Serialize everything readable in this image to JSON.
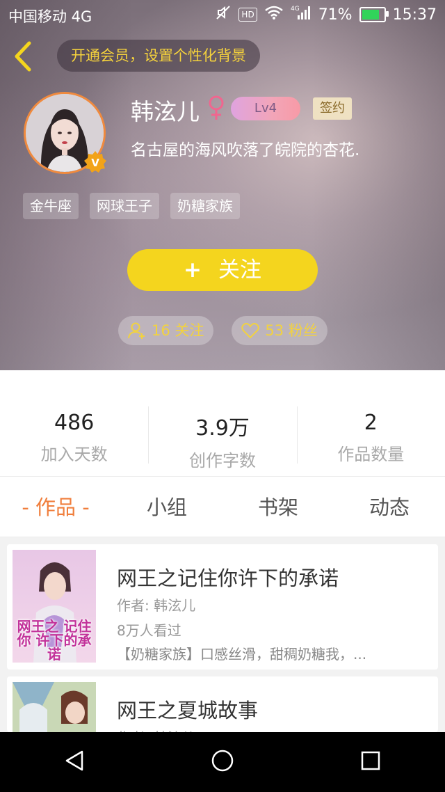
{
  "status_bar": {
    "carrier": "中国移动 4G",
    "network": "4G",
    "battery": "71%",
    "time": "15:37"
  },
  "header": {
    "vip_prompt": "开通会员，设置个性化背景",
    "username": "韩泫儿",
    "gender": "female",
    "level": "Lv4",
    "sign_badge": "签约",
    "bio": "名古屋的海风吹落了皖院的杏花.",
    "tags": [
      "金牛座",
      "网球王子",
      "奶糖家族"
    ],
    "follow_button": "关注",
    "follow_plus": "+",
    "following": "16 关注",
    "fans": "53 粉丝"
  },
  "stats": [
    {
      "value": "486",
      "label": "加入天数"
    },
    {
      "value": "3.9万",
      "label": "创作字数"
    },
    {
      "value": "2",
      "label": "作品数量"
    }
  ],
  "tabs": [
    {
      "label": "- 作品 -",
      "active": true
    },
    {
      "label": "小组"
    },
    {
      "label": "书架"
    },
    {
      "label": "动态"
    }
  ],
  "works": [
    {
      "title": "网王之记住你许下的承诺",
      "author": "作者: 韩泫儿",
      "views": "8万人看过",
      "desc": "【奶糖家族】口感丝滑，甜稠奶糖我，...",
      "cover_text": "网王之 记住你 许下的承诺"
    },
    {
      "title": "网王之夏城故事",
      "author": "作者: 韩泫儿"
    }
  ],
  "colors": {
    "accent": "#f07e3c",
    "yellow": "#f4d51e",
    "badge_text": "#f2d23f"
  }
}
